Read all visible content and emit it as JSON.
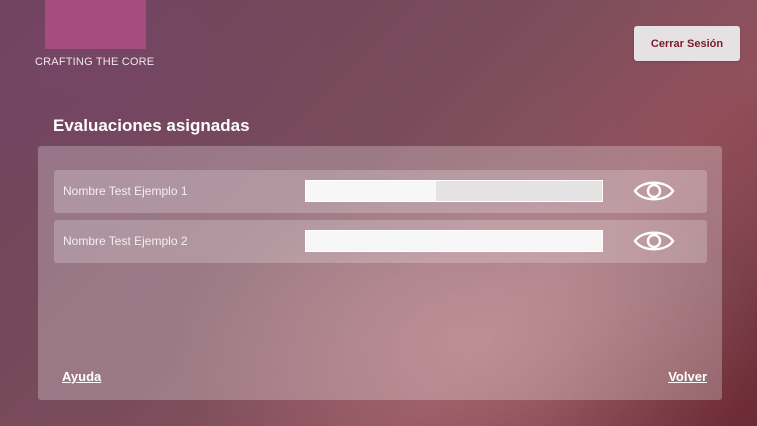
{
  "header": {
    "brand_text": "CRAFTING THE CORE",
    "logout_label": "Cerrar Sesión",
    "brand_color": "#a64c7f"
  },
  "main": {
    "title": "Evaluaciones asignadas",
    "evaluations": [
      {
        "name": "Nombre Test Ejemplo 1",
        "progress": 0.44,
        "action_icon": "eye-icon"
      },
      {
        "name": "Nombre Test Ejemplo 2",
        "progress": 1.0,
        "action_icon": "eye-icon"
      }
    ]
  },
  "footer": {
    "help_label": "Ayuda",
    "back_label": "Volver"
  }
}
